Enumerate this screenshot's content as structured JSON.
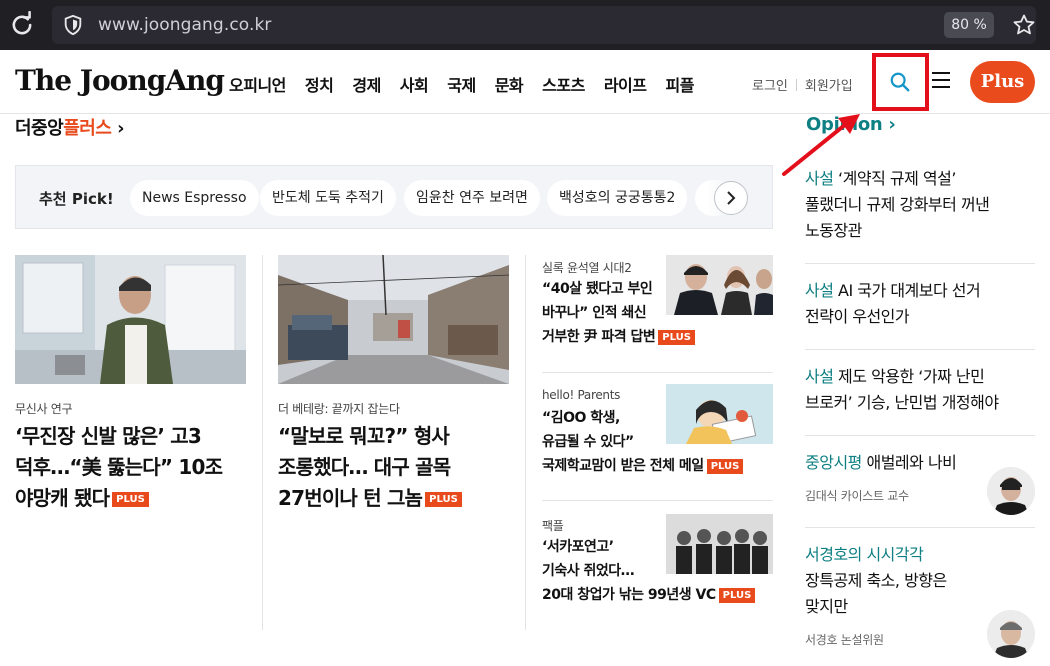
{
  "browser": {
    "url": "www.joongang.co.kr",
    "zoom": "80 %"
  },
  "header": {
    "logo": "The JoongAng",
    "nav": [
      "오피니언",
      "정치",
      "경제",
      "사회",
      "국제",
      "문화",
      "스포츠",
      "라이프",
      "피플"
    ],
    "login": "로그인",
    "signup": "회원가입",
    "plus": "Plus"
  },
  "colors": {
    "accent": "#e84a1c",
    "opinion": "#0e7f82",
    "highlight": "#e3101b"
  },
  "section": {
    "title_main": "더중앙",
    "title_accent": "플러스",
    "chevron": "›"
  },
  "pick": {
    "label": "추천 Pick!",
    "chips": [
      "News Espresso",
      "반도체 도둑 추적기",
      "임윤찬 연주 보려면",
      "백성호의 궁궁통통2"
    ]
  },
  "articles": {
    "a1": {
      "kicker": "무신사 연구",
      "line1": "‘무진장 신발 많은’ 고3",
      "line2": "덕후…“美 뚫는다” 10조",
      "line3": "야망캐 됐다",
      "badge": "PLUS"
    },
    "a2": {
      "kicker": "더 베테랑: 끝까지 잡는다",
      "line1": "“말보로 뭐꼬?” 형사",
      "line2": "조롱했다… 대구 골목",
      "line3": "27번이나 턴 그놈",
      "badge": "PLUS"
    },
    "s1": {
      "kicker": "실록 윤석열 시대2",
      "line1": "“40살 됐다고 부인",
      "line2": "바꾸나” 인적 쇄신",
      "line3": "거부한 尹 파격 답변",
      "badge": "PLUS"
    },
    "s2": {
      "kicker": "hello! Parents",
      "line1": "“김OO 학생,",
      "line2": "유급될 수 있다”",
      "line3": "국제학교맘이 받은 전체 메일",
      "badge": "PLUS"
    },
    "s3": {
      "kicker": "팩플",
      "line1": "‘서카포연고’",
      "line2": "기숙사 쥐었다…",
      "line3": "20대 창업가 낚는 99년생 VC",
      "badge": "PLUS"
    }
  },
  "opinion": {
    "title": "Opinion",
    "chevron": "›",
    "items": [
      {
        "cat": "사설",
        "line1": " ‘계약직 규제 역설’",
        "line2": "풀랬더니 규제 강화부터 꺼낸",
        "line3": "노동장관"
      },
      {
        "cat": "사설",
        "line1": " AI 국가 대계보다 선거",
        "line2": "전략이 우선인가"
      },
      {
        "cat": "사설",
        "line1": " 제도 악용한 ‘가짜 난민",
        "line2": "브로커’ 기승, 난민법 개정해야"
      },
      {
        "cat": "중앙시평",
        "line1": " 애벌레와 나비",
        "author": "김대식 카이스트 교수"
      },
      {
        "cat": "서경호의 시시각각",
        "line2": "장특공제 축소, 방향은",
        "line3": "맞지만",
        "author": "서경호 논설위원"
      }
    ]
  }
}
